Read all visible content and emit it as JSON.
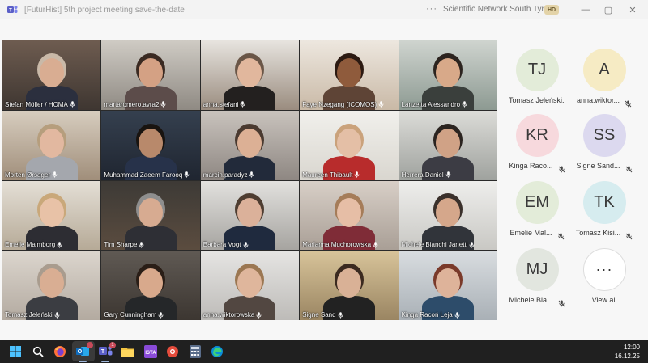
{
  "window": {
    "title": "[FuturHist] 5th project meeting save-the-date",
    "more_label": "···",
    "org_name": "Scientific Network South Tyrol",
    "badge": "HD",
    "app_icon": "teams-icon",
    "controls": {
      "minimize": "—",
      "maximize": "▢",
      "close": "✕"
    }
  },
  "participants": [
    {
      "name": "Stefan Möller / HOMA",
      "mic": "on"
    },
    {
      "name": "martaromero.avra2",
      "mic": "on"
    },
    {
      "name": "anna.stefani",
      "mic": "on"
    },
    {
      "name": "Faye Nzegang (ICOMOS)",
      "mic": "on"
    },
    {
      "name": "Lanzetta Alessandro",
      "mic": "on"
    },
    {
      "name": "Morten Ørsager",
      "mic": "on"
    },
    {
      "name": "Muhammad Zaeem Farooq",
      "mic": "on"
    },
    {
      "name": "marcin.paradyz",
      "mic": "on"
    },
    {
      "name": "Maureen Thibault",
      "mic": "on"
    },
    {
      "name": "Herrera Daniel",
      "mic": "on"
    },
    {
      "name": "Emelie Malmborg",
      "mic": "on"
    },
    {
      "name": "Tim Sharpe",
      "mic": "on"
    },
    {
      "name": "Barbara Vogt",
      "mic": "on"
    },
    {
      "name": "Marianna Muchorowska",
      "mic": "on"
    },
    {
      "name": "Michele Bianchi Janetti",
      "mic": "on"
    },
    {
      "name": "Tomasz Jeleński",
      "mic": "on"
    },
    {
      "name": "Gary Cunningham",
      "mic": "on"
    },
    {
      "name": "anna.wiktorowska",
      "mic": "on"
    },
    {
      "name": "Signe Sand",
      "mic": "on"
    },
    {
      "name": "Kinga Racoń Leja",
      "mic": "on"
    }
  ],
  "roster": [
    {
      "initials": "TJ",
      "name": "Tomasz Jeleński...",
      "color": "#e3ecd9",
      "muted": false
    },
    {
      "initials": "A",
      "name": "anna.wiktor...",
      "color": "#f6ebc4",
      "muted": true
    },
    {
      "initials": "KR",
      "name": "Kinga Raco...",
      "color": "#f7d9dd",
      "muted": true
    },
    {
      "initials": "SS",
      "name": "Signe Sand...",
      "color": "#dcd9ef",
      "muted": true
    },
    {
      "initials": "EM",
      "name": "Emelie Mal...",
      "color": "#e3ecd9",
      "muted": true
    },
    {
      "initials": "TK",
      "name": "Tomasz Kisi...",
      "color": "#d6ecef",
      "muted": true
    },
    {
      "initials": "MJ",
      "name": "Michele Bia...",
      "color": "#e2e6df",
      "muted": true
    }
  ],
  "view_all": {
    "icon": "···",
    "label": "View all"
  },
  "taskbar": {
    "apps": [
      "windows-start-icon",
      "search-icon",
      "firefox-icon",
      "outlook-icon",
      "teams-icon",
      "file-explorer-icon",
      "app-icon",
      "app-icon",
      "calculator-icon",
      "edge-icon"
    ],
    "teams_badge": "1",
    "time": "12:00",
    "date": "16.12.25"
  }
}
